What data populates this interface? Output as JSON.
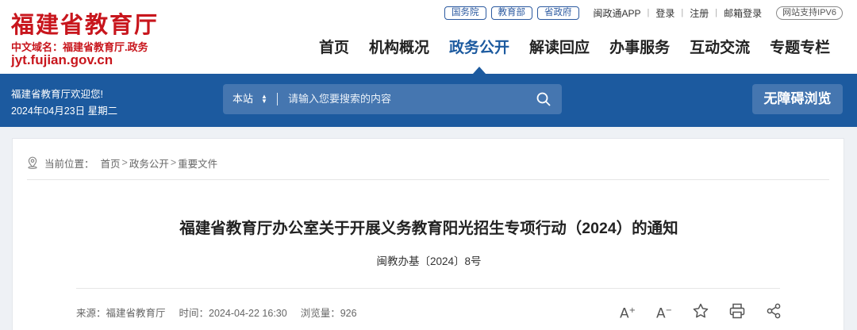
{
  "header": {
    "logo": {
      "title": "福建省教育厅",
      "domain_cn": "中文域名：福建省教育厅.政务",
      "domain": "jyt.fujian.gov.cn"
    },
    "top_links": {
      "org_tags": [
        "国务院",
        "教育部",
        "省政府"
      ],
      "app": "闽政通APP",
      "login": "登录",
      "register": "注册",
      "mail_login": "邮箱登录",
      "ipv6": "网站支持IPV6"
    },
    "nav": [
      {
        "label": "首页",
        "active": false
      },
      {
        "label": "机构概况",
        "active": false
      },
      {
        "label": "政务公开",
        "active": true
      },
      {
        "label": "解读回应",
        "active": false
      },
      {
        "label": "办事服务",
        "active": false
      },
      {
        "label": "互动交流",
        "active": false
      },
      {
        "label": "专题专栏",
        "active": false
      }
    ]
  },
  "band": {
    "welcome": "福建省教育厅欢迎您!",
    "date": "2024年04月23日 星期二",
    "search": {
      "scope": "本站",
      "placeholder": "请输入您要搜索的内容"
    },
    "accessibility_button": "无障碍浏览"
  },
  "article": {
    "breadcrumb": {
      "label": "当前位置：",
      "items": [
        "首页",
        "政务公开",
        "重要文件"
      ]
    },
    "title": "福建省教育厅办公室关于开展义务教育阳光招生专项行动（2024）的通知",
    "doc_no": "闽教办基〔2024〕8号",
    "meta": {
      "source": "来源：福建省教育厅",
      "time": "时间：2024-04-22 16:30",
      "views": "浏览量：926"
    }
  },
  "colors": {
    "brand_red": "#c8161d",
    "primary_blue": "#1c5a9f",
    "search_bg": "#4576b0"
  },
  "icons": [
    "location-icon",
    "search-icon",
    "font-increase-icon",
    "font-decrease-icon",
    "star-icon",
    "print-icon",
    "share-icon"
  ]
}
